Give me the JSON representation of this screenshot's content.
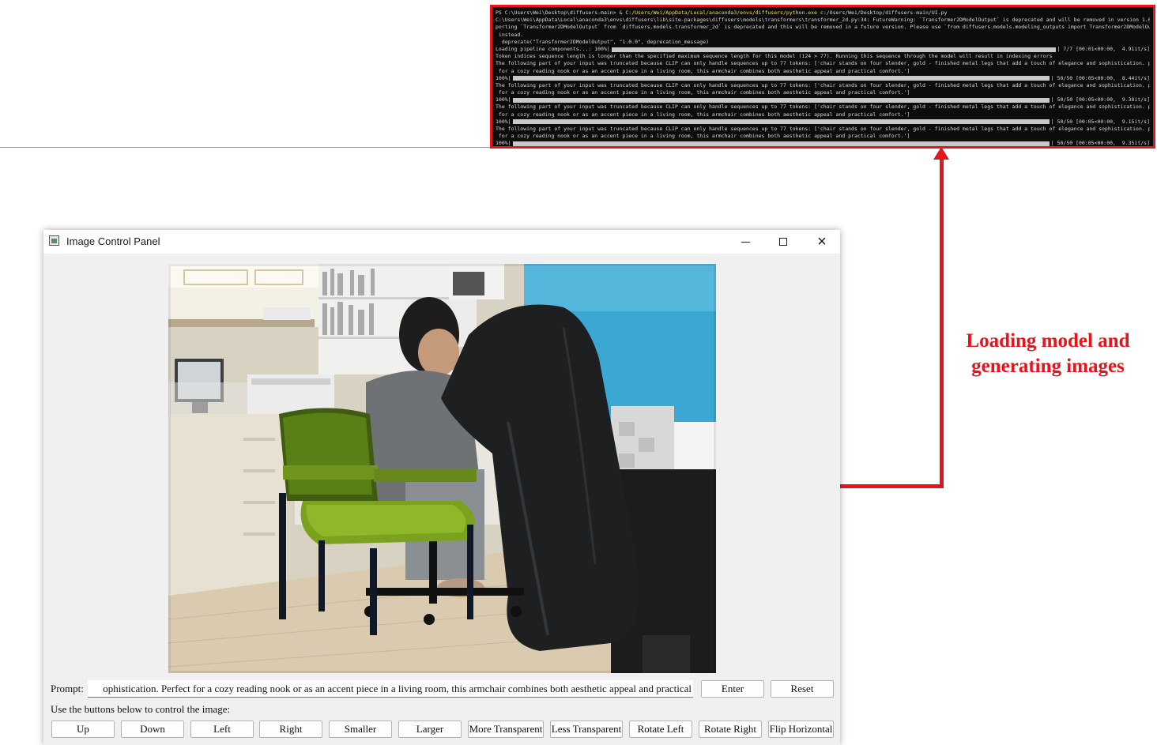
{
  "terminal": {
    "lines": [
      {
        "pre": "PS C:\\Users\\Wei\\Desktop\\diffusers-main> & ",
        "hl": "C:/Users/Wei/AppData/Local/anaconda3/envs/diffusers/python.exe",
        "post": " c:/Users/Wei/Desktop/diffusers-main/UI.py"
      },
      {
        "pre": "C:\\Users\\Wei\\AppData\\Local\\anaconda3\\envs\\diffusers\\lib\\site-packages\\diffusers\\models\\transformers\\transformer_2d.py:34: FutureWarning: `Transformer2DModelOutput` is deprecated and will be removed in version 1.0.0. Im"
      },
      {
        "pre": "porting `Transformer2DModelOutput` from `diffusers.models.transformer_2d` is deprecated and this will be removed in a future version. Please use `from diffusers.models.modeling_outputs import Transformer2DModelOutput`,"
      },
      {
        "pre": " instead."
      },
      {
        "pre": "  deprecate(\"Transformer2DModelOutput\", \"1.0.0\", deprecation_message)"
      },
      {
        "pre": "Loading pipeline components...: 100%|",
        "bar": 1,
        "post": "| 7/7 [00:01<00:00,  4.91it/s]"
      },
      {
        "pre": "Token indices sequence length is longer than the specified maximum sequence length for this model (124 > 77). Running this sequence through the model will result in indexing errors"
      },
      {
        "pre": "The following part of your input was truncated because CLIP can only handle sequences up to 77 tokens: ['chair stands on four slender, gold - finished metal legs that add a touch of elegance and sophistication. perfect"
      },
      {
        "pre": " for a cozy reading nook or as an accent piece in a living room, this armchair combines both aesthetic appeal and practical comfort.']"
      },
      {
        "pre": "100%|",
        "bar": 1,
        "post": "| 50/50 [00:05<00:00,  8.44it/s]"
      },
      {
        "pre": "The following part of your input was truncated because CLIP can only handle sequences up to 77 tokens: ['chair stands on four slender, gold - finished metal legs that add a touch of elegance and sophistication. perfect"
      },
      {
        "pre": " for a cozy reading nook or as an accent piece in a living room, this armchair combines both aesthetic appeal and practical comfort.']"
      },
      {
        "pre": "100%|",
        "bar": 1,
        "post": "| 50/50 [00:05<00:00,  9.38it/s]"
      },
      {
        "pre": "The following part of your input was truncated because CLIP can only handle sequences up to 77 tokens: ['chair stands on four slender, gold - finished metal legs that add a touch of elegance and sophistication. perfect"
      },
      {
        "pre": " for a cozy reading nook or as an accent piece in a living room, this armchair combines both aesthetic appeal and practical comfort.']"
      },
      {
        "pre": "100%|",
        "bar": 1,
        "post": "| 50/50 [00:05<00:00,  9.15it/s]"
      },
      {
        "pre": "The following part of your input was truncated because CLIP can only handle sequences up to 77 tokens: ['chair stands on four slender, gold - finished metal legs that add a touch of elegance and sophistication. perfect"
      },
      {
        "pre": " for a cozy reading nook or as an accent piece in a living room, this armchair combines both aesthetic appeal and practical comfort.']"
      },
      {
        "pre": "100%|",
        "bar": 1,
        "post": "| 50/50 [00:05<00:00,  9.35it/s]"
      }
    ]
  },
  "annotation": {
    "line1": "Loading model and",
    "line2": "generating images",
    "color": "#e8141c"
  },
  "window": {
    "title": "Image Control Panel",
    "minimize_glyph": "minimize-icon",
    "maximize_glyph": "maximize-icon",
    "close_glyph": "×"
  },
  "controls": {
    "prompt_label": "Prompt:",
    "prompt_value": "ophistication. Perfect for a cozy reading nook or as an accent piece in a living room, this armchair combines both aesthetic appeal and practical comfort.",
    "enter_label": "Enter",
    "reset_label": "Reset",
    "hint": "Use the buttons below to control the image:",
    "buttons": [
      "Up",
      "Down",
      "Left",
      "Right",
      "Smaller",
      "Larger",
      "More Transparent",
      "Less Transparent",
      "Rotate Left",
      "Rotate Right",
      "Flip Horizontal"
    ]
  }
}
